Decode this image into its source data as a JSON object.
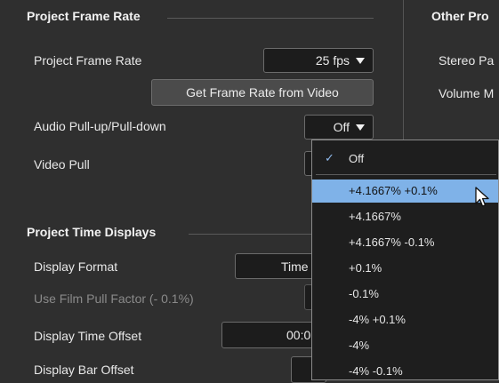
{
  "left": {
    "frame_rate_section": {
      "title": "Project Frame Rate",
      "frame_rate_label": "Project Frame Rate",
      "frame_rate_value": "25 fps",
      "get_frame_rate_button": "Get Frame Rate from Video",
      "pull_label": "Audio Pull-up/Pull-down",
      "pull_value": "Off",
      "video_pull_label": "Video Pull"
    },
    "time_displays_section": {
      "title": "Project Time Displays",
      "display_format_label": "Display Format",
      "display_format_value": "Time",
      "film_pull_label": "Use Film Pull Factor (- 0.1%)",
      "time_offset_label": "Display Time Offset",
      "time_offset_value": "00:0",
      "bar_offset_label": "Display Bar Offset"
    }
  },
  "right": {
    "section_title": "Other Pro",
    "stereo_label": "Stereo Pa",
    "volume_label": "Volume M"
  },
  "popup": {
    "checked_item": "Off",
    "items": [
      "+4.1667% +0.1%",
      "+4.1667%",
      "+4.1667% -0.1%",
      "+0.1%",
      "-0.1%",
      "-4% +0.1%",
      "-4%",
      "-4% -0.1%"
    ]
  },
  "colors": {
    "background": "#2f2f2f",
    "highlight": "#7fb2e8",
    "field_bg": "#1c1c1c"
  }
}
